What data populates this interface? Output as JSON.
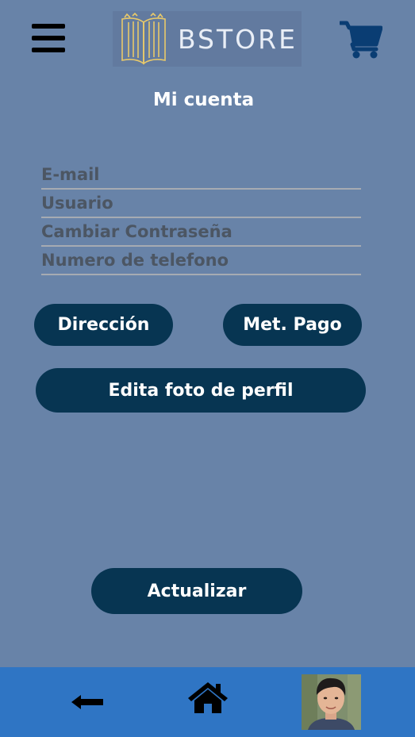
{
  "header": {
    "menu_icon": "hamburger-menu-icon",
    "brand": "BSTORE",
    "brand_icon": "book-icon",
    "cart_icon": "shopping-cart-icon"
  },
  "page": {
    "title": "Mi cuenta"
  },
  "form": {
    "email_placeholder": "E-mail",
    "user_placeholder": "Usuario",
    "password_placeholder": "Cambiar Contraseña",
    "phone_placeholder": "Numero de telefono"
  },
  "buttons": {
    "address": "Dirección",
    "payment": "Met. Pago",
    "edit_photo": "Edita foto de perfil",
    "update": "Actualizar"
  },
  "bottom_nav": {
    "back_icon": "arrow-left-icon",
    "home_icon": "home-icon",
    "profile_icon": "profile-photo"
  },
  "colors": {
    "background": "#6883a8",
    "button": "#073552",
    "bottom_bar": "#2f75c4",
    "cart": "#0a3d73"
  }
}
